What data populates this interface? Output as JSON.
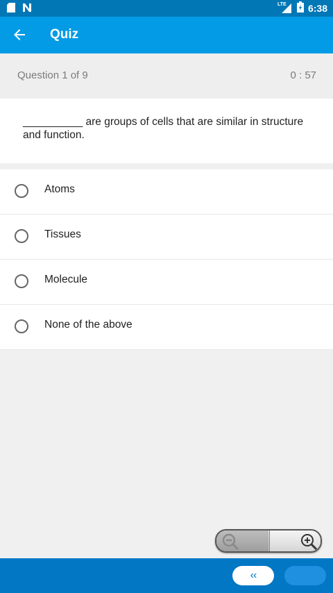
{
  "status": {
    "time": "6:38",
    "network": "LTE",
    "icons": [
      "sd-card-icon",
      "n-notification-icon",
      "signal-icon",
      "battery-charging-icon"
    ]
  },
  "appbar": {
    "title": "Quiz",
    "back_icon": "arrow-left-icon"
  },
  "quiz": {
    "progress": "Question 1 of  9",
    "timer": "0 : 57",
    "question": "__________ are groups of cells that are similar in structure and function.",
    "options": [
      {
        "label": "Atoms"
      },
      {
        "label": "Tissues"
      },
      {
        "label": "Molecule"
      },
      {
        "label": "None of the above"
      }
    ]
  },
  "zoom": {
    "minus_icon": "zoom-out-icon",
    "plus_icon": "zoom-in-icon"
  },
  "navigation": {
    "prev_label": "‹‹"
  },
  "colors": {
    "status_bar": "#0277b6",
    "app_bar": "#039be5",
    "bottom_bar": "#0277c4"
  }
}
